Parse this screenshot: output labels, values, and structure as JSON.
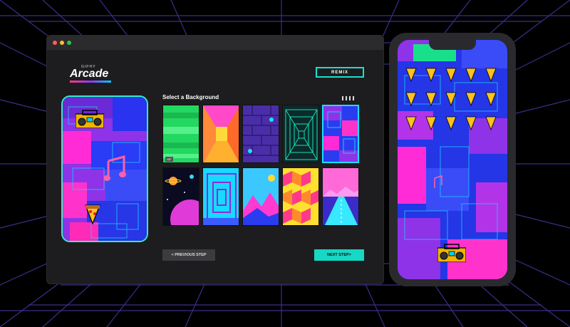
{
  "app": {
    "logo_small": "GIPHY",
    "logo_name": "Arcade",
    "remix_label": "REMIX"
  },
  "step": {
    "title": "Select a Background",
    "prev_label": "< PREVIOUS STEP",
    "next_label": "NEXT STEP>"
  },
  "backgrounds": [
    {
      "name": "green-stripes",
      "badge": "GIF"
    },
    {
      "name": "pink-corridor"
    },
    {
      "name": "purple-bricks"
    },
    {
      "name": "teal-vortex"
    },
    {
      "name": "blue-pixel-blocks",
      "selected": true
    },
    {
      "name": "space-planets"
    },
    {
      "name": "cyan-tunnel"
    },
    {
      "name": "pink-mountains"
    },
    {
      "name": "yellow-cubes"
    },
    {
      "name": "retro-road"
    }
  ],
  "colors": {
    "accent": "#16d8c4",
    "selected_border": "#16e0ff",
    "window_bg": "#1d1d1f",
    "grid_lines": "#3a2f8a"
  },
  "icons": [
    "close-dot",
    "minimize-dot",
    "maximize-dot",
    "boombox-icon",
    "music-note-icon",
    "pizza-icon",
    "grid-view-icon"
  ]
}
